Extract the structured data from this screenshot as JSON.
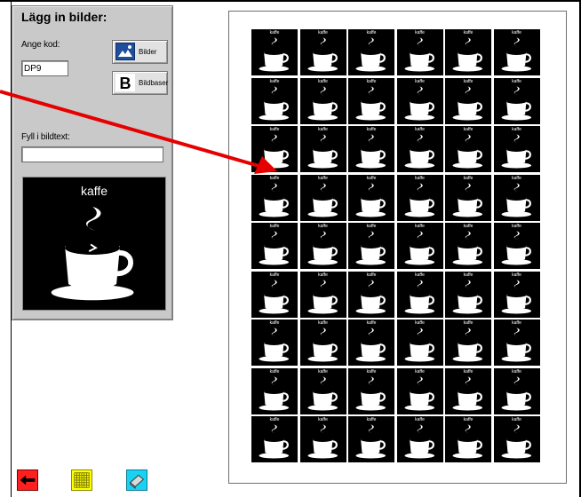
{
  "panel": {
    "title": "Lägg in bilder:",
    "code_label": "Ange kod:",
    "code_value": "DP9",
    "btn_images": "Bilder",
    "btn_imagebases": "Bildbaser",
    "caption_label": "Fyll i bildtext:",
    "caption_value": "",
    "preview_label": "kaffe"
  },
  "sheet": {
    "cell_label": "kaffe",
    "rows": 9,
    "cols": 6
  },
  "toolbar": {
    "back_icon": "red-left-arrow-icon",
    "grid_icon": "yellow-grid-icon",
    "print_icon": "printer-eraser-icon"
  },
  "colors": {
    "panel_bg": "#c9c9c9",
    "arrow": "#e60000",
    "back": "#ff1f1f",
    "grid": "#ffff00",
    "print": "#19d1f3"
  }
}
